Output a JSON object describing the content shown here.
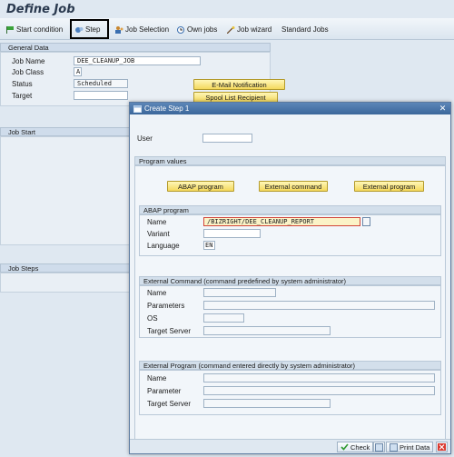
{
  "window": {
    "title": "Define Job"
  },
  "toolbar": {
    "start_condition": "Start condition",
    "step": "Step",
    "job_selection": "Job Selection",
    "own_jobs": "Own jobs",
    "job_wizard": "Job wizard",
    "standard_jobs": "Standard Jobs"
  },
  "general": {
    "header": "General Data",
    "job_name_label": "Job Name",
    "job_name_value": "DEE_CLEANUP_JOB",
    "job_class_label": "Job Class",
    "job_class_value": "A",
    "status_label": "Status",
    "status_value": "Scheduled",
    "target_label": "Target",
    "target_value": "",
    "email_button": "E-Mail Notification",
    "spool_button": "Spool List Recipient"
  },
  "sections": {
    "job_start": "Job Start",
    "job_steps": "Job Steps"
  },
  "dialog": {
    "title": "Create Step  1",
    "user_label": "User",
    "user_value": "",
    "program_values": "Program values",
    "abap_button": "ABAP program",
    "ext_cmd_button": "External command",
    "ext_prog_button": "External program",
    "abap": {
      "header": "ABAP program",
      "name_label": "Name",
      "name_value": "/BIZRIGHT/DEE_CLEANUP_REPORT",
      "variant_label": "Variant",
      "variant_value": "",
      "language_label": "Language",
      "language_value": "EN"
    },
    "ext_cmd": {
      "header": "External Command (command predefined by system administrator)",
      "name_label": "Name",
      "parameters_label": "Parameters",
      "os_label": "OS",
      "target_label": "Target Server"
    },
    "ext_prog": {
      "header": "External Program (command entered directly by system administrator)",
      "name_label": "Name",
      "parameter_label": "Parameter",
      "target_label": "Target Server"
    },
    "footer": {
      "check": "Check",
      "print_data": "Print Data"
    }
  }
}
